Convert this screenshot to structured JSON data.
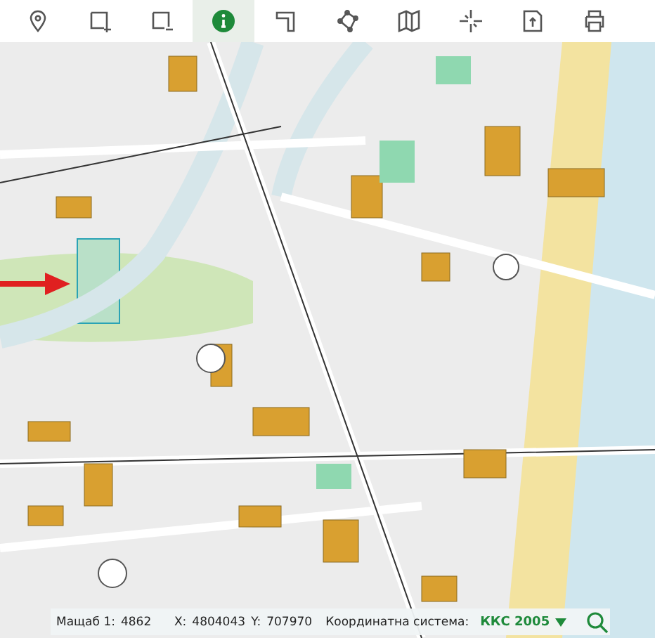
{
  "toolbar": {
    "tools": [
      {
        "kind": "pin",
        "selected": false
      },
      {
        "kind": "rect-plus",
        "selected": false
      },
      {
        "kind": "rect-minus",
        "selected": false
      },
      {
        "kind": "info",
        "selected": true
      },
      {
        "kind": "corner",
        "selected": false
      },
      {
        "kind": "polygon",
        "selected": false
      },
      {
        "kind": "map",
        "selected": false
      },
      {
        "kind": "cross",
        "selected": false
      },
      {
        "kind": "document",
        "selected": false
      },
      {
        "kind": "print",
        "selected": false
      }
    ]
  },
  "status_bar": {
    "scale_label": "Мащаб 1:",
    "scale_value": "4862",
    "x_label": "X:",
    "x_value": "4804043",
    "y_label": "Y:",
    "y_value": "707970",
    "crs_label": "Координатна система:",
    "crs_value": "ККС 2005"
  }
}
